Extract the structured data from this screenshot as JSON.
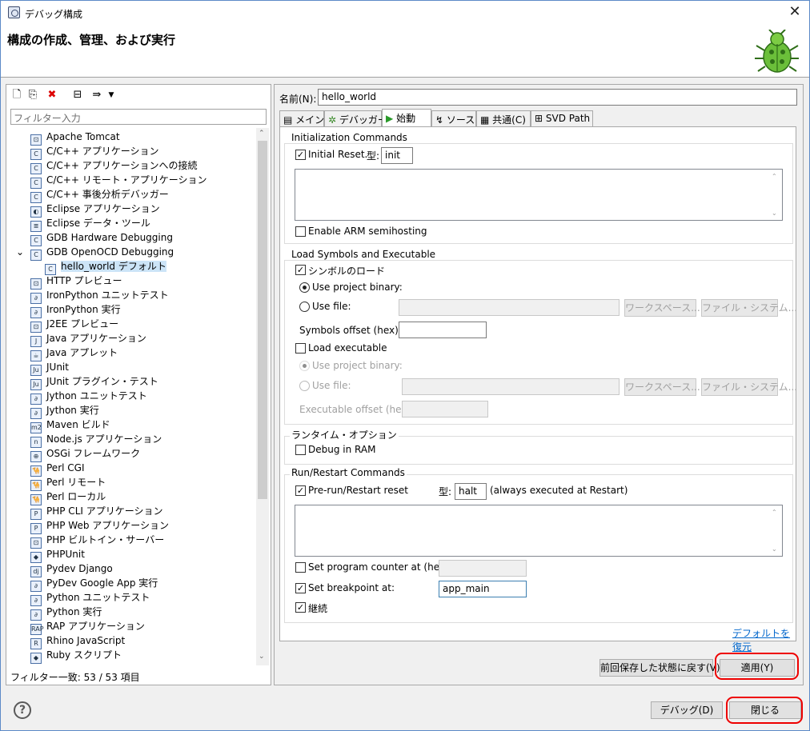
{
  "window": {
    "title": "デバッグ構成",
    "close_glyph": "✕",
    "header_title": "構成の作成、管理、および実行"
  },
  "left": {
    "filter_placeholder": "フィルター入力",
    "tree": [
      {
        "label": "Apache Tomcat",
        "icon": "tomcat-icon",
        "g": "⊡",
        "level": 1
      },
      {
        "label": "C/C++ アプリケーション",
        "icon": "c-app-icon",
        "g": "C",
        "level": 1
      },
      {
        "label": "C/C++ アプリケーションへの接続",
        "icon": "c-attach-icon",
        "g": "C",
        "level": 1
      },
      {
        "label": "C/C++ リモート・アプリケーション",
        "icon": "c-remote-icon",
        "g": "C",
        "level": 1
      },
      {
        "label": "C/C++ 事後分析デバッガー",
        "icon": "c-postmortem-icon",
        "g": "C",
        "level": 1
      },
      {
        "label": "Eclipse アプリケーション",
        "icon": "eclipse-icon",
        "g": "◐",
        "level": 1
      },
      {
        "label": "Eclipse データ・ツール",
        "icon": "data-tools-icon",
        "g": "≣",
        "level": 1
      },
      {
        "label": "GDB Hardware Debugging",
        "icon": "gdb-hw-icon",
        "g": "C",
        "level": 1
      },
      {
        "label": "GDB OpenOCD Debugging",
        "icon": "gdb-openocd-icon",
        "g": "C",
        "level": 1,
        "expanded": true
      },
      {
        "label": "hello_world デフォルト",
        "icon": "c-config-icon",
        "g": "C",
        "level": 2,
        "selected": true
      },
      {
        "label": "HTTP プレビュー",
        "icon": "http-icon",
        "g": "⊡",
        "level": 1
      },
      {
        "label": "IronPython ユニットテスト",
        "icon": "ironpython-test-icon",
        "g": "∂",
        "level": 1
      },
      {
        "label": "IronPython 実行",
        "icon": "ironpython-run-icon",
        "g": "∂",
        "level": 1
      },
      {
        "label": "J2EE プレビュー",
        "icon": "j2ee-icon",
        "g": "⊡",
        "level": 1
      },
      {
        "label": "Java アプリケーション",
        "icon": "java-app-icon",
        "g": "J",
        "level": 1
      },
      {
        "label": "Java アプレット",
        "icon": "java-applet-icon",
        "g": "☕",
        "level": 1
      },
      {
        "label": "JUnit",
        "icon": "junit-icon",
        "g": "Ju",
        "level": 1
      },
      {
        "label": "JUnit プラグイン・テスト",
        "icon": "junit-plugin-icon",
        "g": "Ju",
        "level": 1
      },
      {
        "label": "Jython ユニットテスト",
        "icon": "jython-test-icon",
        "g": "∂",
        "level": 1
      },
      {
        "label": "Jython 実行",
        "icon": "jython-run-icon",
        "g": "∂",
        "level": 1
      },
      {
        "label": "Maven ビルド",
        "icon": "maven-icon",
        "g": "m2",
        "level": 1
      },
      {
        "label": "Node.js アプリケーション",
        "icon": "nodejs-icon",
        "g": "n",
        "level": 1
      },
      {
        "label": "OSGi フレームワーク",
        "icon": "osgi-icon",
        "g": "⊕",
        "level": 1
      },
      {
        "label": "Perl CGI",
        "icon": "perl-cgi-icon",
        "g": "🐪",
        "level": 1
      },
      {
        "label": "Perl リモート",
        "icon": "perl-remote-icon",
        "g": "🐪",
        "level": 1
      },
      {
        "label": "Perl ローカル",
        "icon": "perl-local-icon",
        "g": "🐪",
        "level": 1
      },
      {
        "label": "PHP CLI アプリケーション",
        "icon": "php-cli-icon",
        "g": "P",
        "level": 1
      },
      {
        "label": "PHP Web アプリケーション",
        "icon": "php-web-icon",
        "g": "P",
        "level": 1
      },
      {
        "label": "PHP ビルトイン・サーバー",
        "icon": "php-server-icon",
        "g": "⊡",
        "level": 1
      },
      {
        "label": "PHPUnit",
        "icon": "phpunit-icon",
        "g": "◆",
        "level": 1
      },
      {
        "label": "Pydev Django",
        "icon": "django-icon",
        "g": "dj",
        "level": 1
      },
      {
        "label": "PyDev Google App 実行",
        "icon": "google-app-icon",
        "g": "∂",
        "level": 1
      },
      {
        "label": "Python ユニットテスト",
        "icon": "python-test-icon",
        "g": "∂",
        "level": 1
      },
      {
        "label": "Python 実行",
        "icon": "python-run-icon",
        "g": "∂",
        "level": 1
      },
      {
        "label": "RAP アプリケーション",
        "icon": "rap-icon",
        "g": "RAP",
        "level": 1
      },
      {
        "label": "Rhino JavaScript",
        "icon": "rhino-icon",
        "g": "R",
        "level": 1
      },
      {
        "label": "Ruby スクリプト",
        "icon": "ruby-icon",
        "g": "◆",
        "level": 1
      }
    ],
    "status": "フィルター一致: 53 / 53 項目"
  },
  "right": {
    "name_label": "名前(N):",
    "name_value": "hello_world",
    "tabs": [
      "メイン",
      "デバッガー",
      "始動",
      "ソース",
      "共通(C)",
      "SVD Path"
    ],
    "init": {
      "title": "Initialization Commands",
      "initial_reset": "Initial Reset.",
      "type_label": "型:",
      "type_value": "init",
      "semihosting": "Enable ARM semihosting"
    },
    "load": {
      "title": "Load Symbols and Executable",
      "load_symbols": "シンボルのロード",
      "use_project_binary": "Use project binary:",
      "use_file": "Use file:",
      "workspace_btn": "ワークスペース...",
      "filesystem_btn": "ファイル・システム...",
      "symbols_offset": "Symbols offset (hex):",
      "load_executable": "Load executable",
      "use_project_binary2": "Use project binary:",
      "use_file2": "Use file:",
      "exec_offset": "Executable offset (hex):"
    },
    "runtime": {
      "title": "ランタイム・オプション",
      "debug_in_ram": "Debug in RAM"
    },
    "restart": {
      "title": "Run/Restart Commands",
      "prerun": "Pre-run/Restart reset",
      "type_label": "型:",
      "type_value": "halt",
      "note": "(always executed at Restart)",
      "set_pc": "Set program counter at (hex):",
      "set_bp": "Set breakpoint at:",
      "bp_value": "app_main",
      "continue": "継続"
    },
    "restore_defaults": "デフォルトを復元",
    "revert_btn": "前回保存した状態に戻す(V)",
    "apply_btn": "適用(Y)"
  },
  "bottom": {
    "help": "?",
    "debug_btn": "デバッグ(D)",
    "close_btn": "閉じる"
  },
  "colors": {
    "highlight": "#e00000",
    "selection": "#cce4f7",
    "link": "#0066cc"
  }
}
